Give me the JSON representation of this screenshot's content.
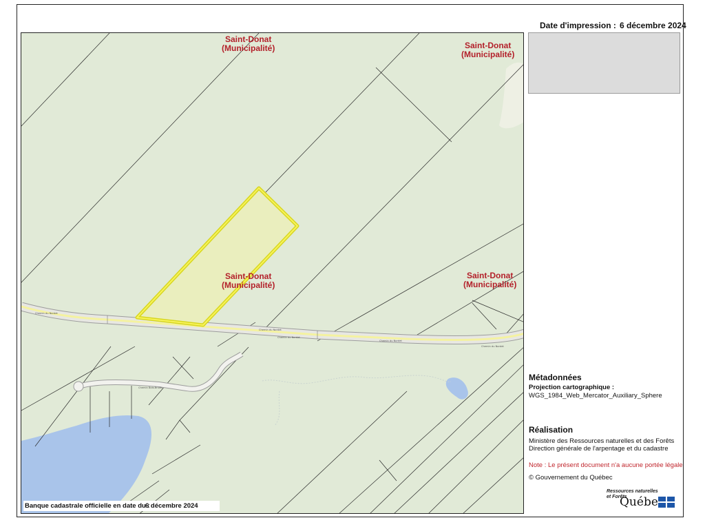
{
  "header": {
    "print_date_label": "Date d'impression :",
    "print_date_value": "6 décembre 2024"
  },
  "map": {
    "municipality_name": "Saint-Donat",
    "municipality_type": "(Municipalité)",
    "road_names": [
      "Chemin du Nordet",
      "Chemin Bois-Brulés"
    ],
    "colors": {
      "land": "#e1ead7",
      "water": "#a9c4ea",
      "road_fill": "#f4f2a0",
      "road_edge": "#aaaaaa",
      "lot_lines": "#222222",
      "selected_lot": "#f0ef2b"
    }
  },
  "bank": {
    "label": "Banque cadastrale officielle en date du :",
    "date": "6 décembre 2024"
  },
  "metadata": {
    "title": "Métadonnées",
    "projection_label": "Projection cartographique :",
    "projection_value": "WGS_1984_Web_Mercator_Auxiliary_Sphere"
  },
  "realisation": {
    "title": "Réalisation",
    "line1": "Ministère des Ressources naturelles et des Forêts",
    "line2": "Direction générale de l'arpentage et du cadastre",
    "note": "Note : Le présent document n'a aucune portée légale",
    "copyright": "© Gouvernement du Québec"
  },
  "logo": {
    "line1": "Ressources naturelles",
    "line2": "et Forêts",
    "name": "Québec",
    "icon": "quebec-flag-icon"
  }
}
